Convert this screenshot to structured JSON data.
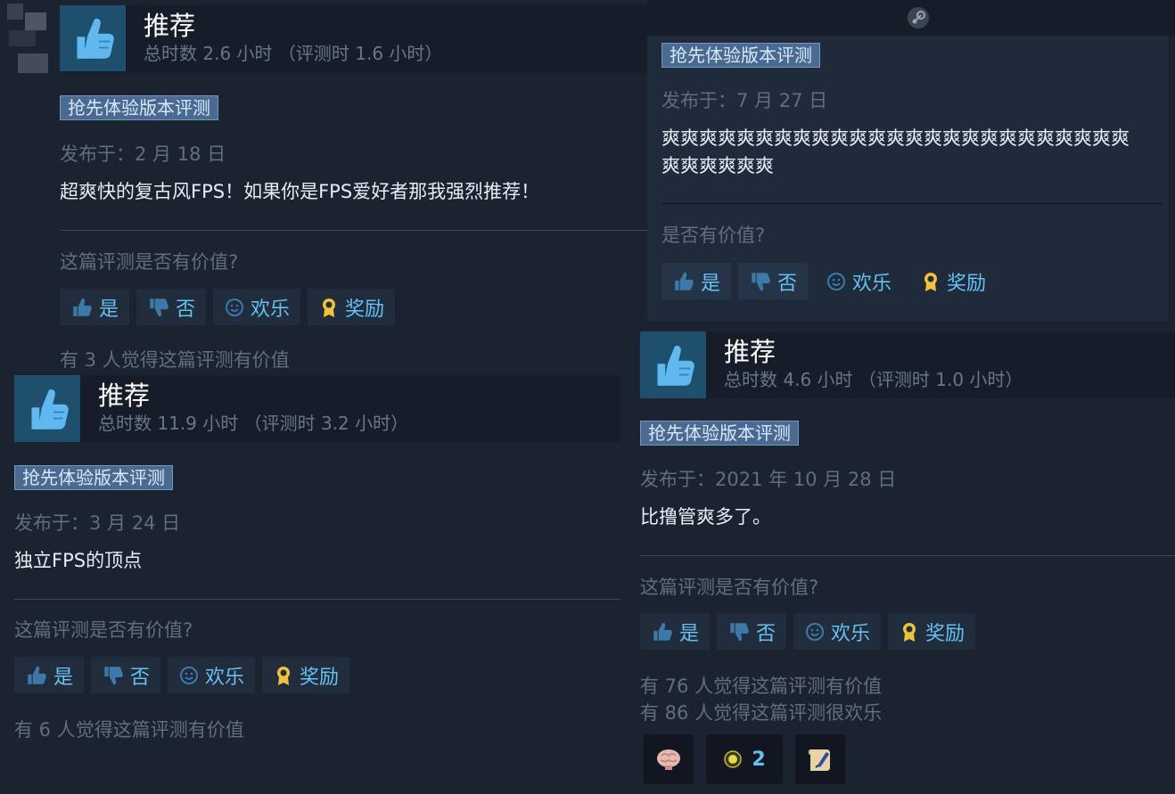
{
  "review_a": {
    "title": "推荐",
    "hours": "总时数 2.6 小时 （评测时 1.6 小时）",
    "badge": "抢先体验版本评测",
    "posted": "发布于：2 月 18 日",
    "body": "超爽快的复古风FPS！如果你是FPS爱好者那我强烈推荐！",
    "question": "这篇评测是否有价值?",
    "votes": {
      "yes": "是",
      "no": "否",
      "funny": "欢乐",
      "award": "奖励"
    },
    "helpful": "有 3 人觉得这篇评测有价值"
  },
  "review_b": {
    "badge": "抢先体验版本评测",
    "posted": "发布于：7 月 27 日",
    "body": "爽爽爽爽爽爽爽爽爽爽爽爽爽爽爽爽爽爽爽爽爽爽爽爽爽爽爽爽爽爽爽",
    "question": "是否有价值?",
    "votes": {
      "yes": "是",
      "no": "否",
      "funny": "欢乐",
      "award": "奖励"
    }
  },
  "review_c": {
    "title": "推荐",
    "hours": "总时数 11.9 小时 （评测时 3.2 小时）",
    "badge": "抢先体验版本评测",
    "posted": "发布于：3 月 24 日",
    "body": "独立FPS的顶点",
    "question": "这篇评测是否有价值?",
    "votes": {
      "yes": "是",
      "no": "否",
      "funny": "欢乐",
      "award": "奖励"
    },
    "helpful": "有 6 人觉得这篇评测有价值"
  },
  "review_d": {
    "title": "推荐",
    "hours": "总时数 4.6 小时 （评测时 1.0 小时）",
    "badge": "抢先体验版本评测",
    "posted": "发布于：2021 年 10 月 28 日",
    "body": "比撸管爽多了。",
    "question": "这篇评测是否有价值?",
    "votes": {
      "yes": "是",
      "no": "否",
      "funny": "欢乐",
      "award": "奖励"
    },
    "helpful": "有 76 人觉得这篇评测有价值",
    "funny_count": "有 86 人觉得这篇评测很欢乐",
    "awards": [
      {
        "icon": "brain-award-icon"
      },
      {
        "icon": "coin-award-icon",
        "count": "2"
      },
      {
        "icon": "scroll-award-icon"
      }
    ]
  },
  "colors": {
    "link": "#66c0f4",
    "thumb_bg": "#1e4f6d",
    "thumb_fg": "#60b8ee",
    "badge_bg": "#4a6a92",
    "award_gold": "#f0c23c"
  }
}
